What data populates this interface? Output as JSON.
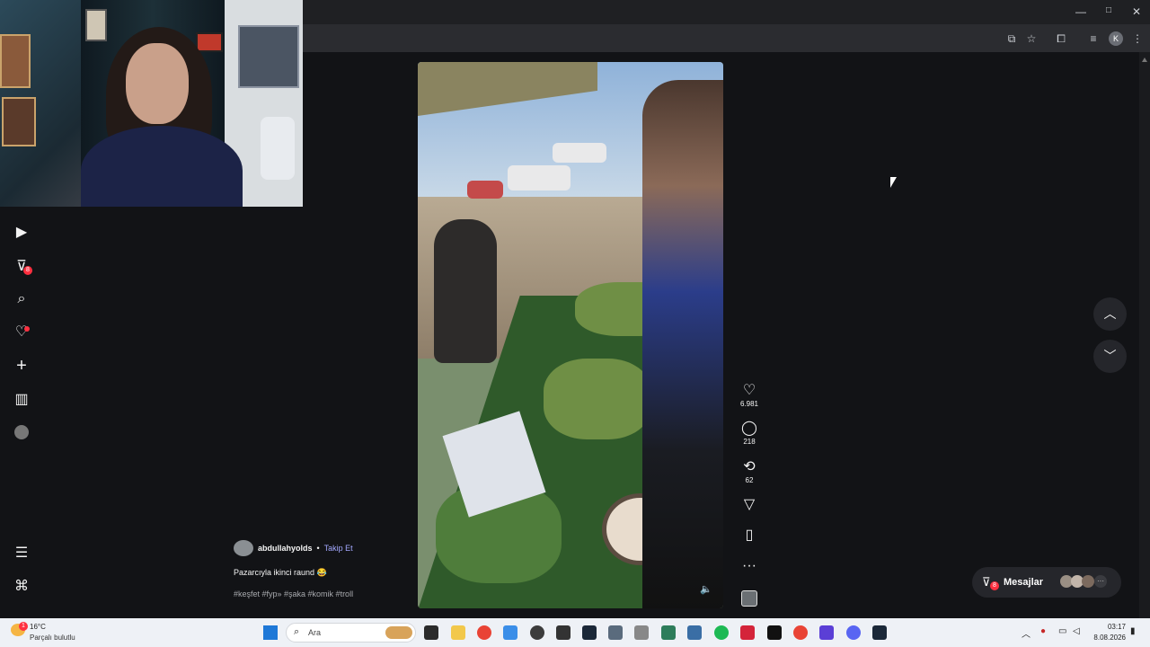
{
  "window": {
    "minimize": "—",
    "maximize": "□",
    "close": "✕"
  },
  "toolbar": {
    "profile_letter": "K"
  },
  "sidebar": {
    "notification_badge": "8"
  },
  "video": {
    "mute_icon": "🔈"
  },
  "actions": {
    "like_count": "6.981",
    "comment_count": "218",
    "repost_count": "62"
  },
  "post": {
    "username": "abdullahyolds",
    "separator": "•",
    "follow_label": "Takip Et",
    "caption": "Pazarcıyla ikinci raund 😂",
    "hashtags": "#keşfet #fyp» #şaka #komik #troll"
  },
  "messages": {
    "label": "Mesajlar",
    "badge": "8"
  },
  "taskbar": {
    "weather_alert": "1",
    "temperature": "16°C",
    "weather_text": "Parçalı bulutlu",
    "search_placeholder": "Ara",
    "time": "03:17",
    "date": "8.08.2026"
  }
}
